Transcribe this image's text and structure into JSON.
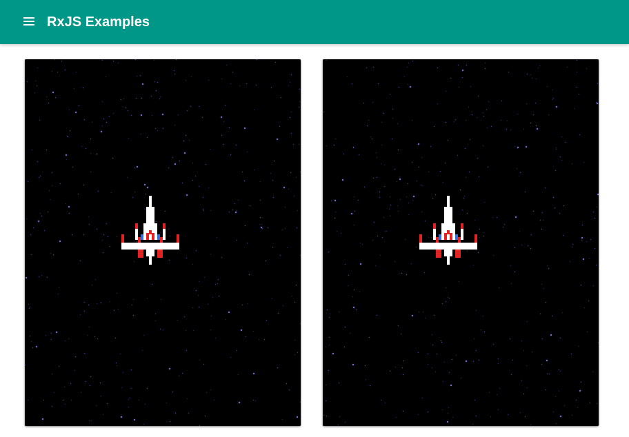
{
  "toolbar": {
    "title": "RxJS Examples",
    "menu_icon": "menu-icon",
    "background_color": "#009688",
    "text_color": "#ffffff"
  },
  "games": [
    {
      "name": "game-canvas-left",
      "background_color": "#000000",
      "star_color": "#6f6ff0",
      "ship_icon": "spaceship-icon"
    },
    {
      "name": "game-canvas-right",
      "background_color": "#000000",
      "star_color": "#6f6ff0",
      "ship_icon": "spaceship-icon"
    }
  ],
  "ship_colors": {
    "body": "#ffffff",
    "accent_red": "#e52222",
    "accent_blue": "#2f6fd6"
  }
}
